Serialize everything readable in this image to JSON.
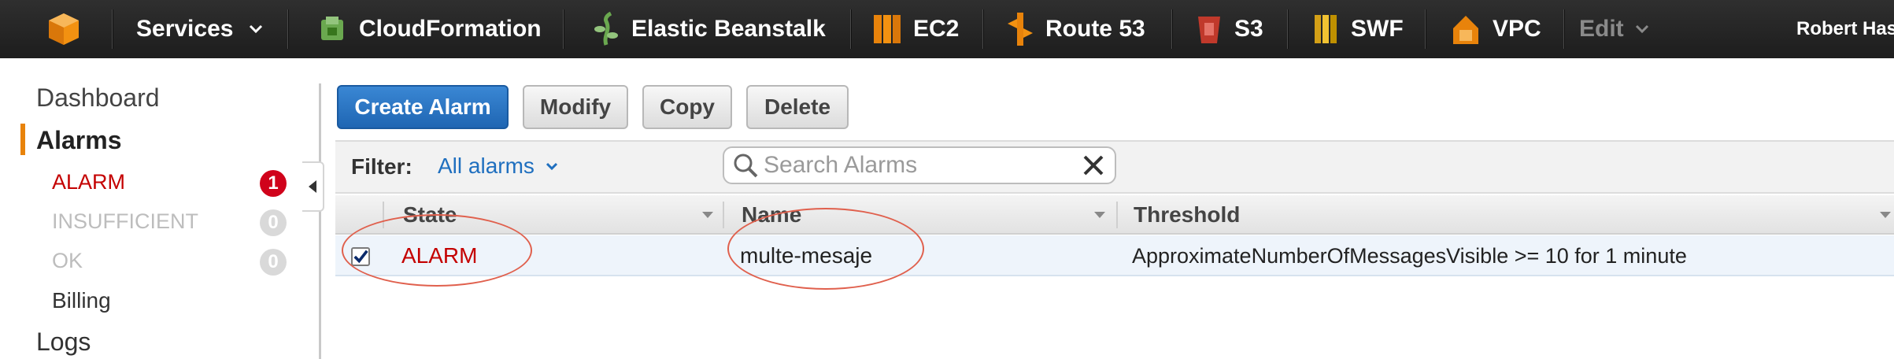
{
  "topnav": {
    "services_label": "Services",
    "items": [
      {
        "label": "CloudFormation",
        "icon": "cloudformation-icon",
        "color": "#6aa84f"
      },
      {
        "label": "Elastic Beanstalk",
        "icon": "elastic-beanstalk-icon",
        "color": "#6aa84f"
      },
      {
        "label": "EC2",
        "icon": "ec2-icon",
        "color": "#e8830b"
      },
      {
        "label": "Route 53",
        "icon": "route53-icon",
        "color": "#e8830b"
      },
      {
        "label": "S3",
        "icon": "s3-icon",
        "color": "#c0392b"
      },
      {
        "label": "SWF",
        "icon": "swf-icon",
        "color": "#d4a017"
      },
      {
        "label": "VPC",
        "icon": "vpc-icon",
        "color": "#e8830b"
      }
    ],
    "edit_label": "Edit",
    "user_label": "Robert Has"
  },
  "sidebar": {
    "dashboard": "Dashboard",
    "alarms": "Alarms",
    "alarm_states": [
      {
        "label": "ALARM",
        "count": "1",
        "color": "#c40000",
        "badge_color": "#d0021b"
      },
      {
        "label": "INSUFFICIENT",
        "count": "0",
        "color": "#bdbdbd",
        "badge_color": "#d9d9d9"
      },
      {
        "label": "OK",
        "count": "0",
        "color": "#bdbdbd",
        "badge_color": "#d9d9d9"
      }
    ],
    "billing": "Billing",
    "logs": "Logs"
  },
  "toolbar": {
    "create_alarm": "Create Alarm",
    "modify": "Modify",
    "copy": "Copy",
    "delete": "Delete"
  },
  "filter": {
    "label": "Filter:",
    "value": "All alarms",
    "search_placeholder": "Search Alarms"
  },
  "table": {
    "headers": {
      "state": "State",
      "name": "Name",
      "threshold": "Threshold"
    },
    "rows": [
      {
        "state": "ALARM",
        "name": "multe-mesaje",
        "threshold": "ApproximateNumberOfMessagesVisible >= 10 for 1 minute",
        "checked": true
      }
    ]
  },
  "colors": {
    "accent": "#e8830b",
    "primary_button": "#2a76c6",
    "alarm_red": "#c40000",
    "link_blue": "#1f6fbf"
  }
}
